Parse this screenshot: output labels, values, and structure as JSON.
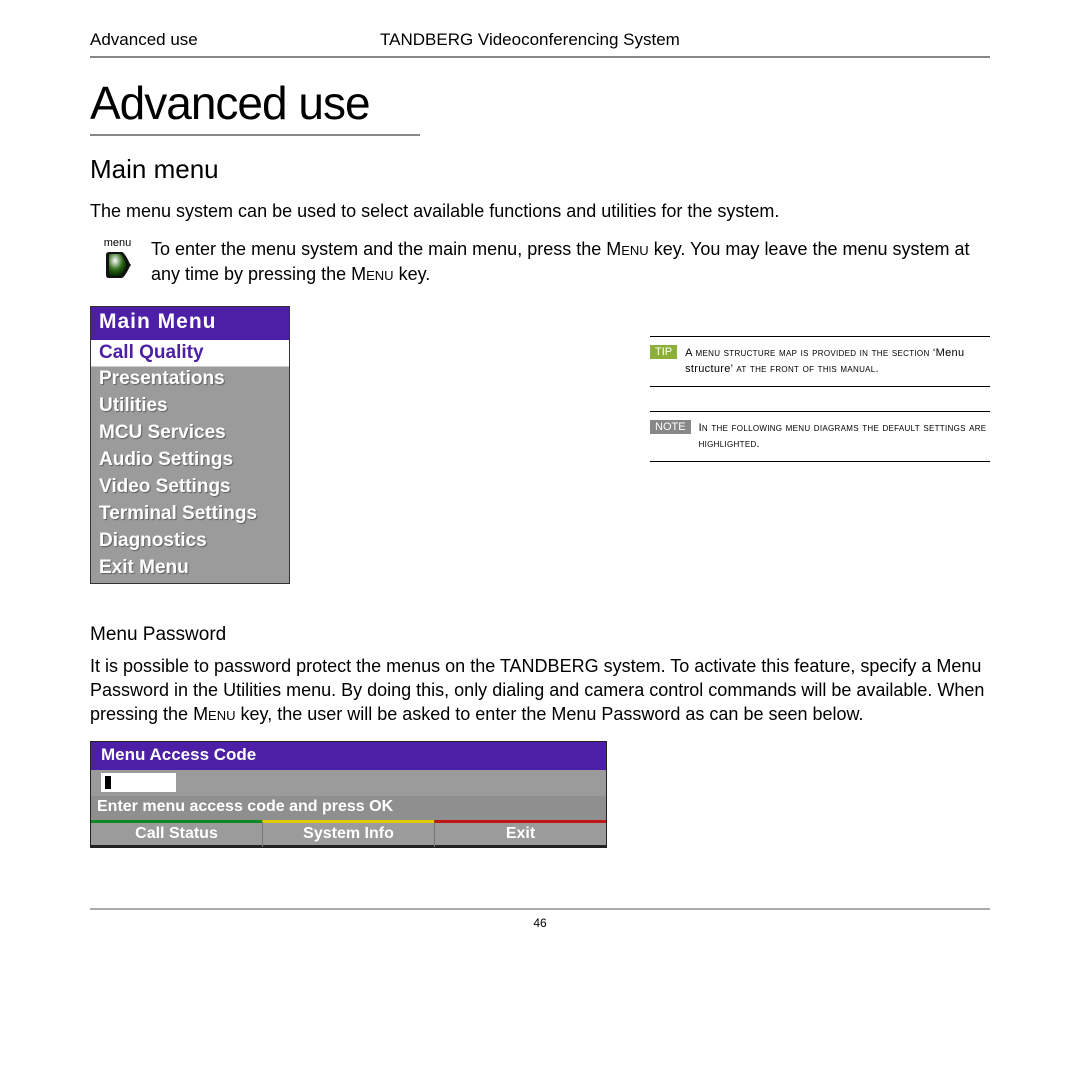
{
  "header": {
    "section": "Advanced use",
    "product": "TANDBERG Videoconferencing System"
  },
  "title": "Advanced use",
  "subtitle": "Main menu",
  "intro": "The menu system can be used to select available functions and utilities for the system.",
  "menu_icon_label": "menu",
  "menu_instruction_pre": "To enter the menu system and the main menu, press the ",
  "menu_key1": "Menu",
  "menu_instruction_mid": " key. You may leave the menu system at any time by pressing the ",
  "menu_key2": "Menu",
  "menu_instruction_post": " key.",
  "main_menu": {
    "title": "Main Menu",
    "items": [
      "Call Quality",
      "Presentations",
      "Utilities",
      "MCU Services",
      "Audio Settings",
      "Video Settings",
      "Terminal Settings",
      "Diagnostics",
      "Exit Menu"
    ]
  },
  "tip": {
    "label": "TIP",
    "text_pre": "A menu structure map is provided in the section ‘",
    "text_em": "Menu structure",
    "text_post": "’ at the front of this manual."
  },
  "note": {
    "label": "NOTE",
    "text": "In the following menu diagrams the default settings are highlighted."
  },
  "password": {
    "heading": "Menu Password",
    "body_pre": "It is possible to password protect the menus on the TANDBERG system. To activate this feature,  specify a Menu Password in the Utilities menu. By doing this, only dialing and camera control commands will be available. When pressing the  ",
    "key": "Menu",
    "body_post": " key, the user will be asked to enter the Menu Password as can be seen below."
  },
  "access_code": {
    "title": "Menu Access Code",
    "prompt": "Enter menu access code and press OK",
    "buttons": [
      "Call Status",
      "System Info",
      "Exit"
    ]
  },
  "page_number": "46"
}
